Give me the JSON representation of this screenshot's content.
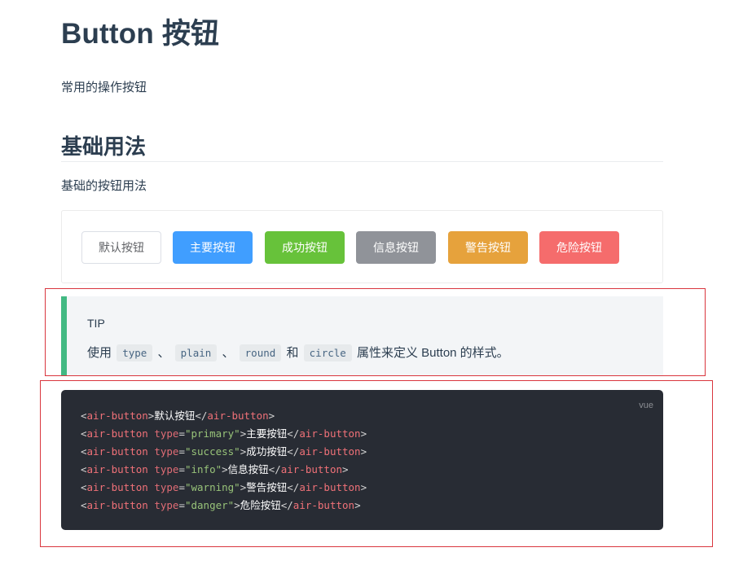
{
  "page": {
    "title": "Button 按钮",
    "lead": "常用的操作按钮"
  },
  "section": {
    "heading": "基础用法",
    "description": "基础的按钮用法"
  },
  "demo": {
    "buttons": [
      {
        "type": "default",
        "label": "默认按钮",
        "color": "#ffffff"
      },
      {
        "type": "primary",
        "label": "主要按钮",
        "color": "#409eff"
      },
      {
        "type": "success",
        "label": "成功按钮",
        "color": "#67c23a"
      },
      {
        "type": "info",
        "label": "信息按钮",
        "color": "#909399"
      },
      {
        "type": "warning",
        "label": "警告按钮",
        "color": "#e6a23c"
      },
      {
        "type": "danger",
        "label": "危险按钮",
        "color": "#f56c6c"
      }
    ]
  },
  "tip": {
    "title": "TIP",
    "prefix": "使用",
    "codes": [
      "type",
      "plain",
      "round",
      "circle"
    ],
    "separators": [
      "、",
      "、",
      "和"
    ],
    "suffix": "属性来定义 Button 的样式。",
    "accent_color": "#42b983"
  },
  "code": {
    "lang": "vue",
    "background": "#282c34",
    "lines": [
      {
        "tag": "air-button",
        "attr": "",
        "value": "",
        "text": "默认按钮"
      },
      {
        "tag": "air-button",
        "attr": "type",
        "value": "primary",
        "text": "主要按钮"
      },
      {
        "tag": "air-button",
        "attr": "type",
        "value": "success",
        "text": "成功按钮"
      },
      {
        "tag": "air-button",
        "attr": "type",
        "value": "info",
        "text": "信息按钮"
      },
      {
        "tag": "air-button",
        "attr": "type",
        "value": "warning",
        "text": "警告按钮"
      },
      {
        "tag": "air-button",
        "attr": "type",
        "value": "danger",
        "text": "危险按钮"
      }
    ]
  },
  "annotations": {
    "frame_color": "#d9363e"
  }
}
